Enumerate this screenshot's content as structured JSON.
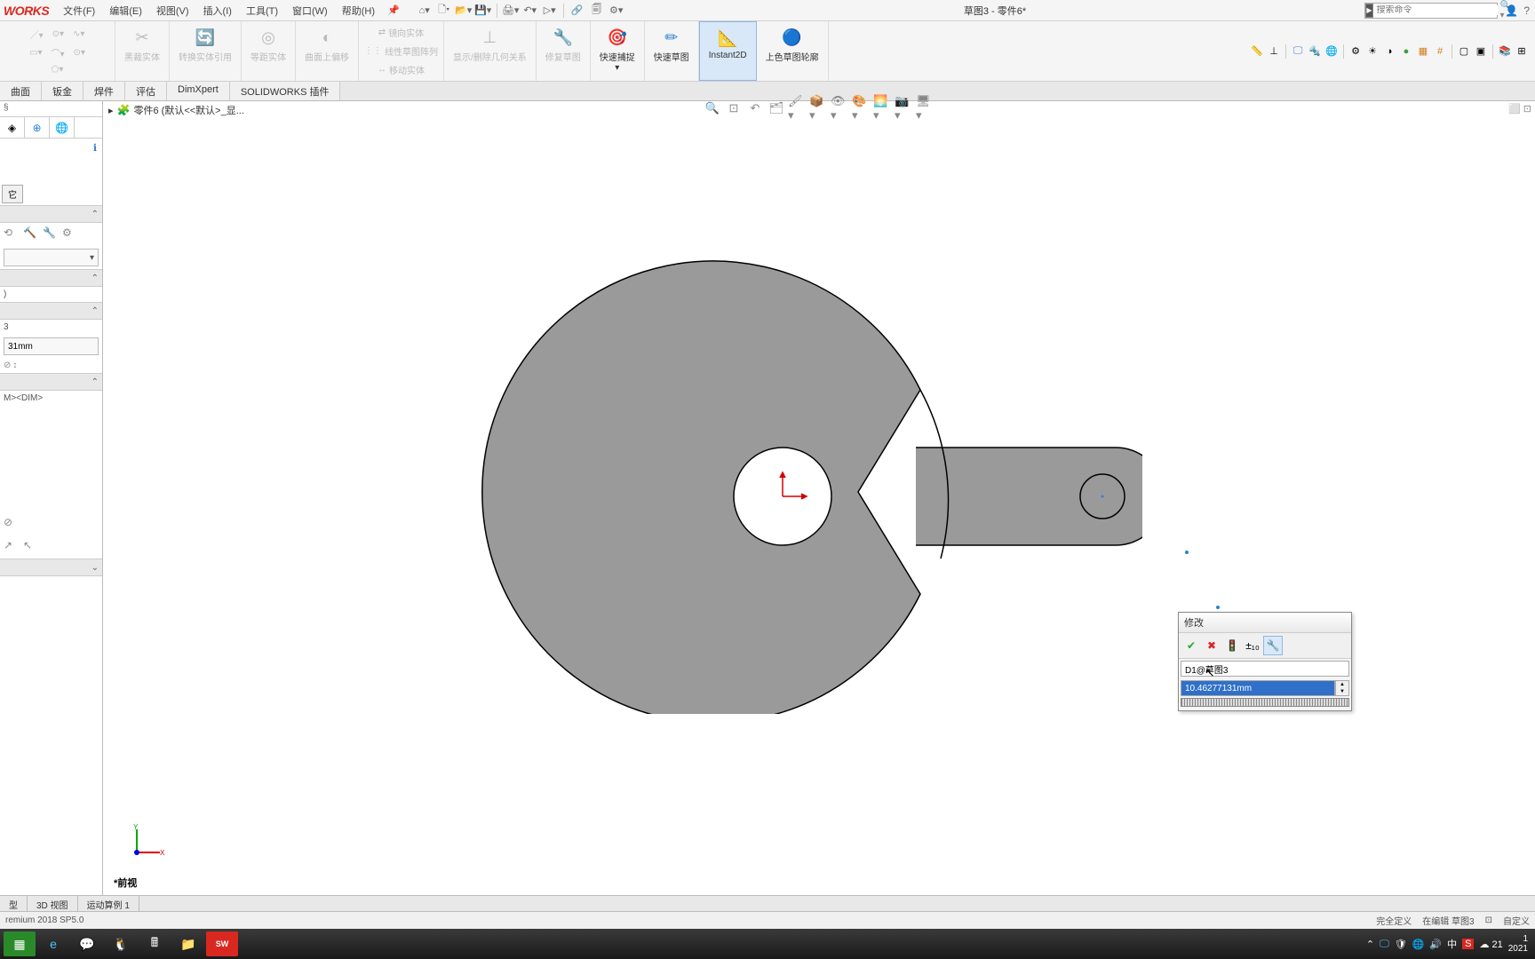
{
  "app": {
    "logo": "WORKS",
    "title": "草图3 - 零件6*"
  },
  "menu": {
    "file": "文件(F)",
    "edit": "编辑(E)",
    "view": "视图(V)",
    "insert": "插入(I)",
    "tools": "工具(T)",
    "window": "窗口(W)",
    "help": "帮助(H)"
  },
  "search": {
    "placeholder": "搜索命令"
  },
  "ribbon": {
    "mirror": "镜向实体",
    "linear": "线性草图阵列",
    "move": "移动实体",
    "convert": "转换实体引用",
    "convert2": "等距实体",
    "convert3": "曲面上偏移",
    "trim": "黑裁实体",
    "show_del": "显示/删除几何关系",
    "repair": "修复草图",
    "quick_snap": "快速捕捉",
    "quick_sketch": "快速草图",
    "instant2d": "Instant2D",
    "shade": "上色草图轮廓"
  },
  "tabs": {
    "surface": "曲面",
    "sheetmetal": "钣金",
    "weld": "焊件",
    "evaluate": "评估",
    "dimxpert": "DimXpert",
    "addins": "SOLIDWORKS 插件"
  },
  "breadcrumb": "零件6  (默认<<默认>_显...",
  "left_panel": {
    "btn_other": "它",
    "dim_name": "3",
    "dim_value": "31mm",
    "tol": "M><DIM>"
  },
  "modify_dlg": {
    "title": "修改",
    "name": "D1@草图3",
    "value": "10.46277131mm"
  },
  "view_label": "前视",
  "bottom_tabs": {
    "model": "型",
    "view3d": "3D 视图",
    "motion": "运动算例 1"
  },
  "status": {
    "left": "remium 2018 SP5.0",
    "def": "完全定义",
    "editing": "在编辑 草图3",
    "custom": "自定义"
  },
  "taskbar": {
    "ime": "中",
    "temp": "21",
    "time": "1",
    "date": "2021"
  }
}
